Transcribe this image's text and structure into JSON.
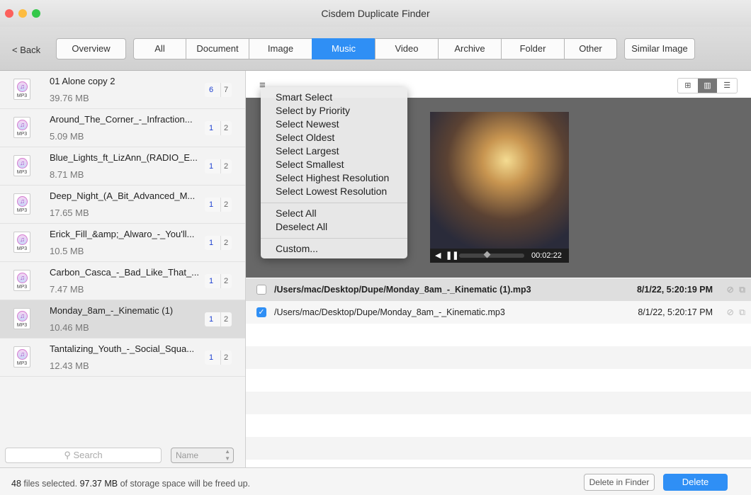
{
  "window": {
    "title": "Cisdem Duplicate Finder"
  },
  "toolbar": {
    "back": "< Back",
    "overview": "Overview",
    "tabs": [
      "All",
      "Document",
      "Image",
      "Music",
      "Video",
      "Archive",
      "Folder",
      "Other"
    ],
    "active_tab": "Music",
    "similar_image": "Similar Image"
  },
  "groups": [
    {
      "name": "01 Alone copy 2",
      "size": "39.76 MB",
      "selected": "6",
      "total": "7"
    },
    {
      "name": "Around_The_Corner_-_Infraction...",
      "size": "5.09 MB",
      "selected": "1",
      "total": "2"
    },
    {
      "name": "Blue_Lights_ft_LizAnn_(RADIO_E...",
      "size": "8.71 MB",
      "selected": "1",
      "total": "2"
    },
    {
      "name": "Deep_Night_(A_Bit_Advanced_M...",
      "size": "17.65 MB",
      "selected": "1",
      "total": "2"
    },
    {
      "name": "Erick_Fill_&amp;_Alwaro_-_You'll...",
      "size": "10.5 MB",
      "selected": "1",
      "total": "2"
    },
    {
      "name": "Carbon_Casca_-_Bad_Like_That_...",
      "size": "7.47 MB",
      "selected": "1",
      "total": "2"
    },
    {
      "name": "Monday_8am_-_Kinematic (1)",
      "size": "10.46 MB",
      "selected": "1",
      "total": "2"
    },
    {
      "name": "Tantalizing_Youth_-_Social_Squa...",
      "size": "12.43 MB",
      "selected": "1",
      "total": "2"
    }
  ],
  "sidebar": {
    "search_placeholder": "Search",
    "sort": "Name"
  },
  "menu": {
    "group1": [
      "Smart Select",
      "Select by Priority",
      "Select Newest",
      "Select Oldest",
      "Select Largest",
      "Select Smallest",
      "Select Highest Resolution",
      "Select Lowest Resolution"
    ],
    "group2": [
      "Select All",
      "Deselect All"
    ],
    "group3": [
      "Custom..."
    ]
  },
  "player": {
    "time": "00:02:22",
    "progress": 0.42
  },
  "files": [
    {
      "path": "/Users/mac/Desktop/Dupe/Monday_8am_-_Kinematic (1).mp3",
      "date": "8/1/22, 5:20:19 PM",
      "checked": false
    },
    {
      "path": "/Users/mac/Desktop/Dupe/Monday_8am_-_Kinematic.mp3",
      "date": "8/1/22, 5:20:17 PM",
      "checked": true
    }
  ],
  "status": {
    "count": "48",
    "count_text": " files selected. ",
    "size": "97.37 MB",
    "size_text": " of storage space will be freed up."
  },
  "actions": {
    "delete_in_finder": "Delete in Finder",
    "delete": "Delete"
  },
  "colors": {
    "accent": "#2f8ff5",
    "count_blue": "#1c3fd1"
  }
}
